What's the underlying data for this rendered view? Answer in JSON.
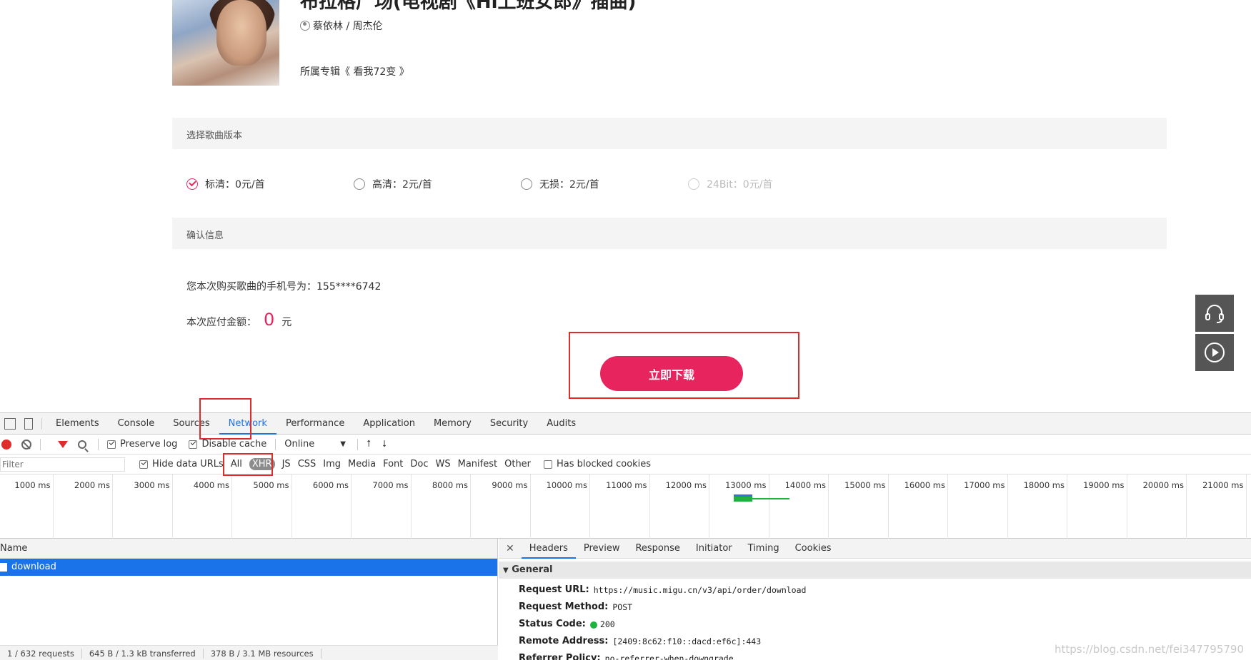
{
  "page": {
    "song_title": "布拉格广场(电视剧《Hi上班女郎》插曲)",
    "artist": "蔡依林 / 周杰伦",
    "album": "所属专辑《 看我72变 》",
    "section_version": "选择歌曲版本",
    "versions": [
      {
        "label": "标清：0元/首",
        "selected": true,
        "disabled": false
      },
      {
        "label": "高清：2元/首",
        "selected": false,
        "disabled": false
      },
      {
        "label": "无损：2元/首",
        "selected": false,
        "disabled": false
      },
      {
        "label": "24Bit：0元/首",
        "selected": false,
        "disabled": true
      }
    ],
    "section_confirm": "确认信息",
    "phone_line": "您本次购买歌曲的手机号为：155****6742",
    "pay_label": "本次应付金额：",
    "pay_amount": "0",
    "pay_unit": "元",
    "download_button": "立即下载"
  },
  "devtools": {
    "tabs": [
      "Elements",
      "Console",
      "Sources",
      "Network",
      "Performance",
      "Application",
      "Memory",
      "Security",
      "Audits"
    ],
    "active_tab": "Network",
    "toolbar": {
      "preserve_log": "Preserve log",
      "disable_cache": "Disable cache",
      "throttle": "Online"
    },
    "filter": {
      "placeholder": "Filter",
      "hide_data_urls": "Hide data URLs",
      "types": [
        "All",
        "XHR",
        "JS",
        "CSS",
        "Img",
        "Media",
        "Font",
        "Doc",
        "WS",
        "Manifest",
        "Other"
      ],
      "active_type": "XHR",
      "blocked_cookies": "Has blocked cookies"
    },
    "timeline_ticks": [
      "1000 ms",
      "2000 ms",
      "3000 ms",
      "4000 ms",
      "5000 ms",
      "6000 ms",
      "7000 ms",
      "8000 ms",
      "9000 ms",
      "10000 ms",
      "11000 ms",
      "12000 ms",
      "13000 ms",
      "14000 ms",
      "15000 ms",
      "16000 ms",
      "17000 ms",
      "18000 ms",
      "19000 ms",
      "20000 ms",
      "21000 ms"
    ],
    "list": {
      "name_header": "Name",
      "rows": [
        "download"
      ],
      "status": [
        "1 / 632 requests",
        "645 B / 1.3 kB transferred",
        "378 B / 3.1 MB resources"
      ]
    },
    "details": {
      "tabs": [
        "Headers",
        "Preview",
        "Response",
        "Initiator",
        "Timing",
        "Cookies"
      ],
      "active_tab": "Headers",
      "general_label": "General",
      "fields": [
        {
          "key": "Request URL:",
          "value": "https://music.migu.cn/v3/api/order/download"
        },
        {
          "key": "Request Method:",
          "value": "POST"
        },
        {
          "key": "Status Code:",
          "value": "200"
        },
        {
          "key": "Remote Address:",
          "value": "[2409:8c62:f10::dacd:ef6c]:443"
        },
        {
          "key": "Referrer Policy:",
          "value": "no-referrer-when-downgrade"
        }
      ]
    }
  },
  "watermark": "https://blog.csdn.net/fei347795790"
}
